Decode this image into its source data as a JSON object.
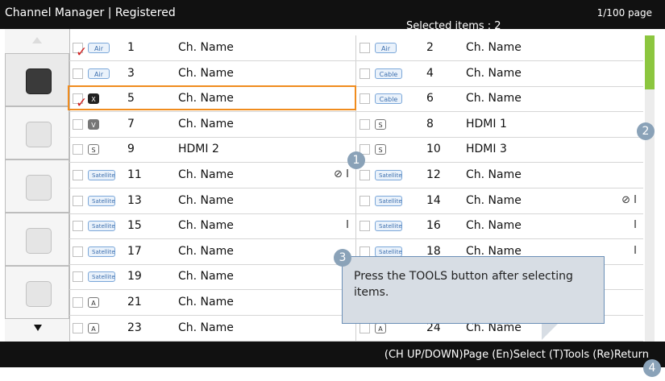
{
  "header": {
    "title": "Channel Manager | Registered",
    "page": "1/100 page",
    "selected": "Selected items : 2"
  },
  "rows": [
    {
      "left": {
        "checked": true,
        "badge": "Air",
        "badge_type": "air",
        "num": "1",
        "name": "Ch. Name",
        "icons": ""
      },
      "right": {
        "checked": false,
        "badge": "Air",
        "badge_type": "air",
        "num": "2",
        "name": "Ch. Name",
        "icons": ""
      }
    },
    {
      "left": {
        "checked": false,
        "badge": "Air",
        "badge_type": "air",
        "num": "3",
        "name": "Ch. Name",
        "icons": ""
      },
      "right": {
        "checked": false,
        "badge": "Cable",
        "badge_type": "cable",
        "num": "4",
        "name": "Ch. Name",
        "icons": ""
      }
    },
    {
      "left": {
        "checked": true,
        "badge": "X",
        "badge_type": "dark",
        "num": "5",
        "name": "Ch. Name",
        "icons": ""
      },
      "right": {
        "checked": false,
        "badge": "Cable",
        "badge_type": "cable",
        "num": "6",
        "name": "Ch. Name",
        "icons": ""
      }
    },
    {
      "left": {
        "checked": false,
        "badge": "V",
        "badge_type": "gray",
        "num": "7",
        "name": "Ch. Name",
        "icons": ""
      },
      "right": {
        "checked": false,
        "badge": "S",
        "badge_type": "box",
        "num": "8",
        "name": "HDMI 1",
        "icons": ""
      }
    },
    {
      "left": {
        "checked": false,
        "badge": "S",
        "badge_type": "box",
        "num": "9",
        "name": "HDMI 2",
        "icons": ""
      },
      "right": {
        "checked": false,
        "badge": "S",
        "badge_type": "box",
        "num": "10",
        "name": "HDMI 3",
        "icons": ""
      }
    },
    {
      "left": {
        "checked": false,
        "badge": "Satellite",
        "badge_type": "sat",
        "num": "11",
        "name": "Ch. Name",
        "icons": "⊘ I"
      },
      "right": {
        "checked": false,
        "badge": "Satellite",
        "badge_type": "sat",
        "num": "12",
        "name": "Ch. Name",
        "icons": ""
      }
    },
    {
      "left": {
        "checked": false,
        "badge": "Satellite",
        "badge_type": "sat",
        "num": "13",
        "name": "Ch. Name",
        "icons": ""
      },
      "right": {
        "checked": false,
        "badge": "Satellite",
        "badge_type": "sat",
        "num": "14",
        "name": "Ch. Name",
        "icons": "⊘ I"
      }
    },
    {
      "left": {
        "checked": false,
        "badge": "Satellite",
        "badge_type": "sat",
        "num": "15",
        "name": "Ch. Name",
        "icons": "I"
      },
      "right": {
        "checked": false,
        "badge": "Satellite",
        "badge_type": "sat",
        "num": "16",
        "name": "Ch. Name",
        "icons": "I"
      }
    },
    {
      "left": {
        "checked": false,
        "badge": "Satellite",
        "badge_type": "sat",
        "num": "17",
        "name": "Ch. Name",
        "icons": ""
      },
      "right": {
        "checked": false,
        "badge": "Satellite",
        "badge_type": "sat",
        "num": "18",
        "name": "Ch. Name",
        "icons": "I"
      }
    },
    {
      "left": {
        "checked": false,
        "badge": "Satellite",
        "badge_type": "sat",
        "num": "19",
        "name": "Ch. Name",
        "icons": ""
      },
      "right": null
    },
    {
      "left": {
        "checked": false,
        "badge": "A",
        "badge_type": "box",
        "num": "21",
        "name": "Ch. Name",
        "icons": ""
      },
      "right": null
    },
    {
      "left": {
        "checked": false,
        "badge": "A",
        "badge_type": "box",
        "num": "23",
        "name": "Ch. Name",
        "icons": ""
      },
      "right": {
        "checked": false,
        "badge": "A",
        "badge_type": "box",
        "num": "24",
        "name": "Ch. Name",
        "icons": ""
      }
    }
  ],
  "footer": {
    "help": "(CH UP/DOWN)Page  (En)Select  (T)Tools  (Re)Return"
  },
  "tooltip": {
    "text": "Press the TOOLS button after selecting items."
  },
  "callouts": [
    "1",
    "2",
    "3",
    "4"
  ],
  "colors": {
    "accent_orange": "#f08c1e",
    "scroll_green": "#8cc63f",
    "check_red": "#d21e1e"
  }
}
